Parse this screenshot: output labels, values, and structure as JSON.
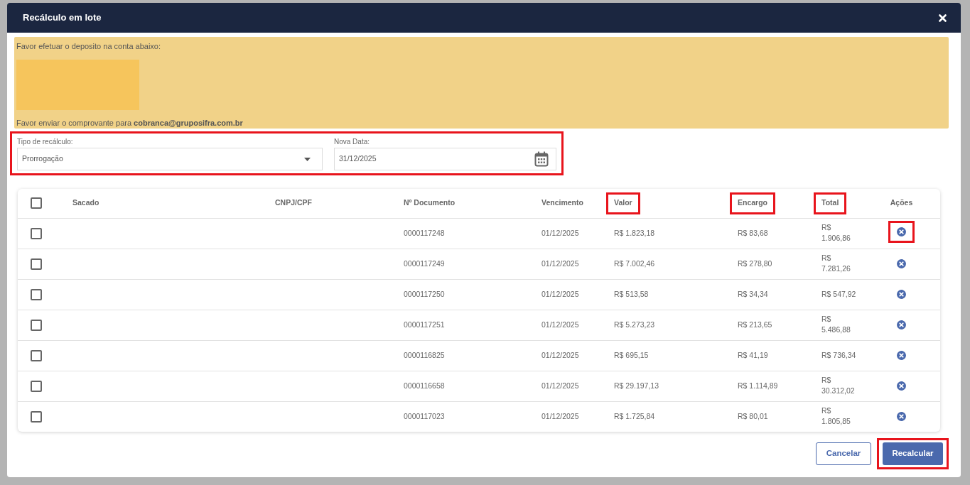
{
  "modal": {
    "title": "Recálculo em lote"
  },
  "notice": {
    "intro": "Favor efetuar o deposito na conta abaixo:",
    "footer": "Favor enviar o comprovante para **cobranca@gruposifra.com.br**"
  },
  "form": {
    "highlighted": true,
    "fields": [
      {
        "kind": "select",
        "label": "Tipo de recálculo:",
        "value": "Prorrogação"
      },
      {
        "kind": "date",
        "label": "Nova Data:",
        "value": "31/12/2025"
      }
    ]
  },
  "table": {
    "select_all": {
      "checked": false
    },
    "columns": [
      {
        "label": "Sacado",
        "highlighted": false
      },
      {
        "label": "CNPJ/CPF",
        "highlighted": false
      },
      {
        "label": "Nº Documento",
        "highlighted": false
      },
      {
        "label": "Vencimento",
        "highlighted": false
      },
      {
        "label": "Valor",
        "highlighted": true
      },
      {
        "label": "Encargo",
        "highlighted": true
      },
      {
        "label": "Total",
        "highlighted": true
      },
      {
        "label": "Ações",
        "highlighted": false
      }
    ],
    "rows": [
      {
        "checked": false,
        "documento": "0000117248",
        "vencimento": "01/12/2025",
        "valor": "R$ 1.823,18",
        "encargo": "R$ 83,68",
        "total": "R$ 1.906,86",
        "action_highlighted": true
      },
      {
        "checked": false,
        "documento": "0000117249",
        "vencimento": "01/12/2025",
        "valor": "R$ 7.002,46",
        "encargo": "R$ 278,80",
        "total": "R$ 7.281,26",
        "action_highlighted": false
      },
      {
        "checked": false,
        "documento": "0000117250",
        "vencimento": "01/12/2025",
        "valor": "R$ 513,58",
        "encargo": "R$ 34,34",
        "total": "R$ 547,92",
        "action_highlighted": false
      },
      {
        "checked": false,
        "documento": "0000117251",
        "vencimento": "01/12/2025",
        "valor": "R$ 5.273,23",
        "encargo": "R$ 213,65",
        "total": "R$ 5.486,88",
        "action_highlighted": false
      },
      {
        "checked": false,
        "documento": "0000116825",
        "vencimento": "01/12/2025",
        "valor": "R$ 695,15",
        "encargo": "R$ 41,19",
        "total": "R$ 736,34",
        "action_highlighted": false
      },
      {
        "checked": false,
        "documento": "0000116658",
        "vencimento": "01/12/2025",
        "valor": "R$ 29.197,13",
        "encargo": "R$ 1.114,89",
        "total": "R$ 30.312,02",
        "action_highlighted": false
      },
      {
        "checked": false,
        "documento": "0000117023",
        "vencimento": "01/12/2025",
        "valor": "R$ 1.725,84",
        "encargo": "R$ 80,01",
        "total": "R$ 1.805,85",
        "action_highlighted": false
      }
    ]
  },
  "buttons": [
    {
      "kind": "secondary",
      "label": "Cancelar",
      "highlighted": false
    },
    {
      "kind": "primary",
      "label": "Recalcular",
      "highlighted": true
    }
  ]
}
